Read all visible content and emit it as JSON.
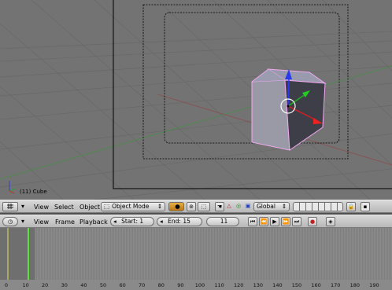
{
  "viewport": {
    "object_label": "(11) Cube",
    "axis_icon": "axis-gizmo-icon",
    "colors": {
      "background": "#737373",
      "grid": "#666666",
      "x_axis": "#8a4a4a",
      "y_axis": "#4a8a4a",
      "cube_face": "#8c8c9c",
      "cube_dark": "#3a3a44",
      "selection": "#f0a8f0"
    }
  },
  "header3d": {
    "menu_view": "View",
    "menu_select": "Select",
    "menu_object": "Object",
    "mode_select": "Object Mode",
    "orientation_select": "Global"
  },
  "timeline_header": {
    "menu_view": "View",
    "menu_frame": "Frame",
    "menu_playback": "Playback",
    "start_field": "Start: 1",
    "end_field": "End: 15",
    "current_frame": "11"
  },
  "timeline": {
    "ticks": [
      "0",
      "10",
      "20",
      "30",
      "40",
      "50",
      "60",
      "70",
      "80",
      "90",
      "100",
      "110",
      "120",
      "130",
      "140",
      "150",
      "160",
      "170",
      "180",
      "190"
    ],
    "current_frame_color": "#5fe03a",
    "start_marker_color": "#e6e05a"
  }
}
